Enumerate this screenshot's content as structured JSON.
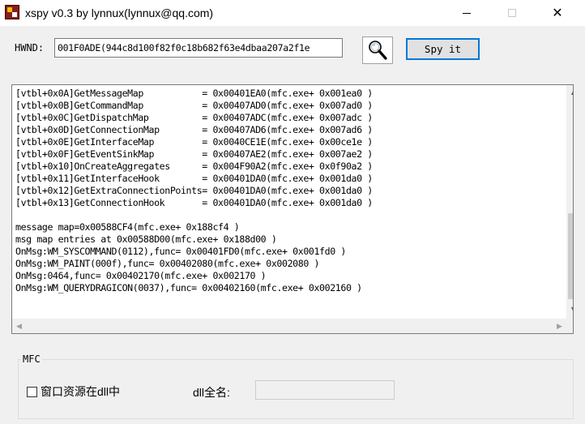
{
  "window": {
    "title": "xspy v0.3 by lynnux(lynnux@qq.com)",
    "minimize_glyph": "—",
    "maximize_glyph": "☐",
    "close_glyph": "✕"
  },
  "toolbar": {
    "hwnd_label": "HWND:",
    "hwnd_value": "001F0ADE(944c8d100f82f0c18b682f63e4dbaa207a2f1e",
    "finder_icon": "magnifier-icon",
    "spy_label": "Spy it"
  },
  "output": {
    "lines": [
      "[vtbl+0x0A]GetMessageMap           = 0x00401EA0(mfc.exe+ 0x001ea0 )",
      "[vtbl+0x0B]GetCommandMap           = 0x00407AD0(mfc.exe+ 0x007ad0 )",
      "[vtbl+0x0C]GetDispatchMap          = 0x00407ADC(mfc.exe+ 0x007adc )",
      "[vtbl+0x0D]GetConnectionMap        = 0x00407AD6(mfc.exe+ 0x007ad6 )",
      "[vtbl+0x0E]GetInterfaceMap         = 0x0040CE1E(mfc.exe+ 0x00ce1e )",
      "[vtbl+0x0F]GetEventSinkMap         = 0x00407AE2(mfc.exe+ 0x007ae2 )",
      "[vtbl+0x10]OnCreateAggregates      = 0x004F90A2(mfc.exe+ 0x0f90a2 )",
      "[vtbl+0x11]GetInterfaceHook        = 0x00401DA0(mfc.exe+ 0x001da0 )",
      "[vtbl+0x12]GetExtraConnectionPoints= 0x00401DA0(mfc.exe+ 0x001da0 )",
      "[vtbl+0x13]GetConnectionHook       = 0x00401DA0(mfc.exe+ 0x001da0 )",
      "",
      "message map=0x00588CF4(mfc.exe+ 0x188cf4 )",
      "msg map entries at 0x00588D00(mfc.exe+ 0x188d00 )",
      "OnMsg:WM_SYSCOMMAND(0112),func= 0x00401FD0(mfc.exe+ 0x001fd0 )",
      "OnMsg:WM_PAINT(000f),func= 0x00402080(mfc.exe+ 0x002080 )",
      "OnMsg:0464,func= 0x00402170(mfc.exe+ 0x002170 )",
      "OnMsg:WM_QUERYDRAGICON(0037),func= 0x00402160(mfc.exe+ 0x002160 )"
    ],
    "scroll_up_glyph": "▲",
    "scroll_down_glyph": "▼",
    "scroll_left_glyph": "◀",
    "scroll_right_glyph": "▶"
  },
  "mfc": {
    "group_label": "MFC",
    "checkbox_label": "窗口资源在dll中",
    "checkbox_checked": false,
    "dll_name_label": "dll全名:",
    "dll_name_value": ""
  },
  "colors": {
    "accent": "#0078d7",
    "window_bg": "#f0f0f0"
  }
}
